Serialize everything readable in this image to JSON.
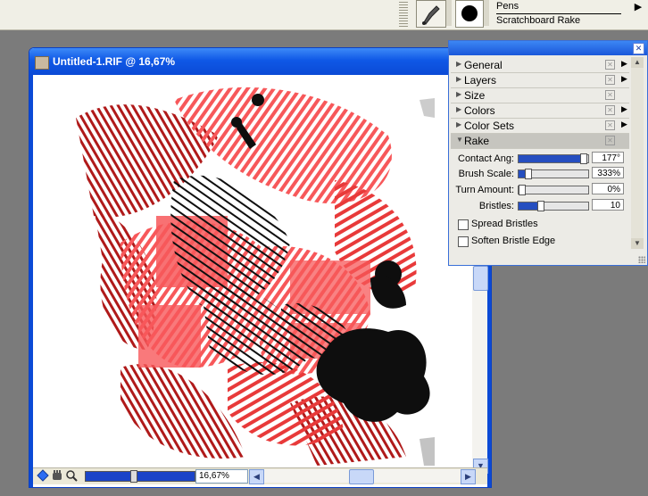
{
  "property_bar": {
    "brush_category": "Pens",
    "brush_variant": "Scratchboard Rake",
    "menu_arrow": "▶"
  },
  "document": {
    "title": "Untitled-1.RIF @ 16,67%",
    "zoom": "16,67%"
  },
  "brush_controls": {
    "sections": [
      {
        "label": "General",
        "more": "▶"
      },
      {
        "label": "Layers",
        "more": "▶"
      },
      {
        "label": "Size",
        "more": ""
      },
      {
        "label": "Colors",
        "more": "▶"
      },
      {
        "label": "Color Sets",
        "more": "▶"
      },
      {
        "label": "Rake",
        "more": ""
      }
    ],
    "rake": {
      "contact_angle": {
        "label": "Contact Ang:",
        "value": "177°",
        "level": 0.98
      },
      "brush_scale": {
        "label": "Brush Scale:",
        "value": "333%",
        "level": 0.1
      },
      "turn_amount": {
        "label": "Turn Amount:",
        "value": "0%",
        "level": 0.0
      },
      "bristles": {
        "label": "Bristles:",
        "value": "10",
        "level": 0.3
      },
      "spread_bristles": {
        "label": "Spread Bristles",
        "checked": false
      },
      "soften_bristle_edge": {
        "label": "Soften Bristle Edge",
        "checked": false
      }
    }
  },
  "colors": {
    "title_blue": "#0f58e6",
    "stroke_dark_red": "#b01a1a",
    "stroke_red": "#e83a3a",
    "stroke_salmon": "#f7585a",
    "stroke_black": "#0e0e0e"
  }
}
